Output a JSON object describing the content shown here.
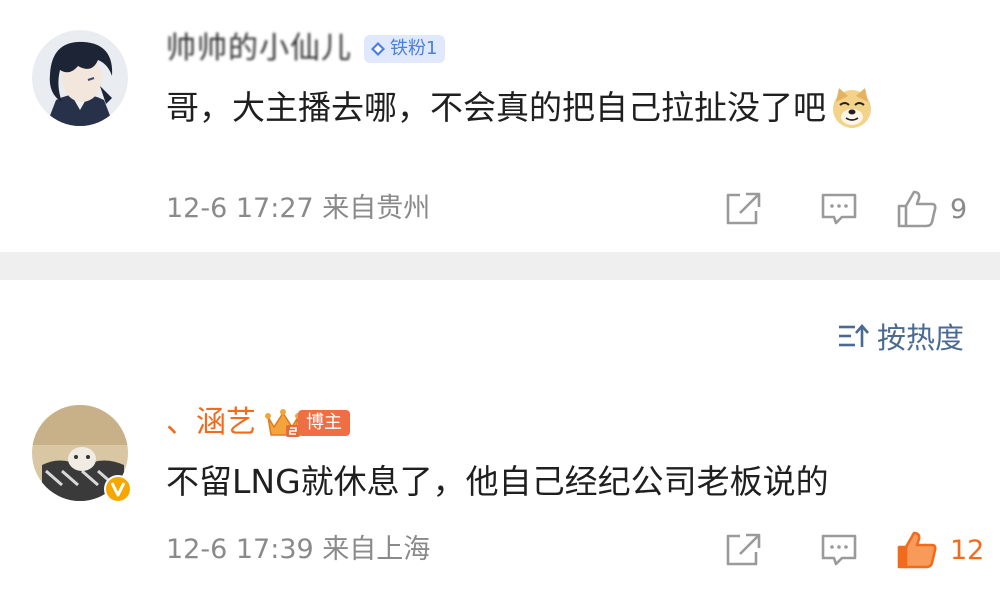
{
  "comments": [
    {
      "username": "帅帅的小仙儿",
      "badge": "铁粉1",
      "text": "哥，大主播去哪，不会真的把自己拉扯没了吧",
      "emoji": "doge-emoji",
      "meta": "12-6 17:27 来自贵州",
      "likes": "9",
      "liked": false
    },
    {
      "username": "、涵艺",
      "badge": "博主",
      "text": "不留LNG就休息了，他自己经纪公司老板说的",
      "meta": "12-6 17:39 来自上海",
      "likes": "12",
      "liked": true
    }
  ],
  "sort": {
    "label": "按热度",
    "icon": "sort-icon"
  },
  "icons": {
    "share": "share-icon",
    "reply": "comment-icon",
    "like": "thumbs-up-icon",
    "fan_badge": "diamond-icon",
    "blogger_badge": "crown-icon",
    "verified": "vip-v-icon"
  },
  "colors": {
    "accent_orange": "#f26b1d",
    "meta_gray": "#8a8a8a",
    "fan_badge_bg": "#dfe9fb",
    "fan_badge_text": "#4a7fe0",
    "sort_blue": "#4a6a94",
    "separator": "#efefef"
  }
}
